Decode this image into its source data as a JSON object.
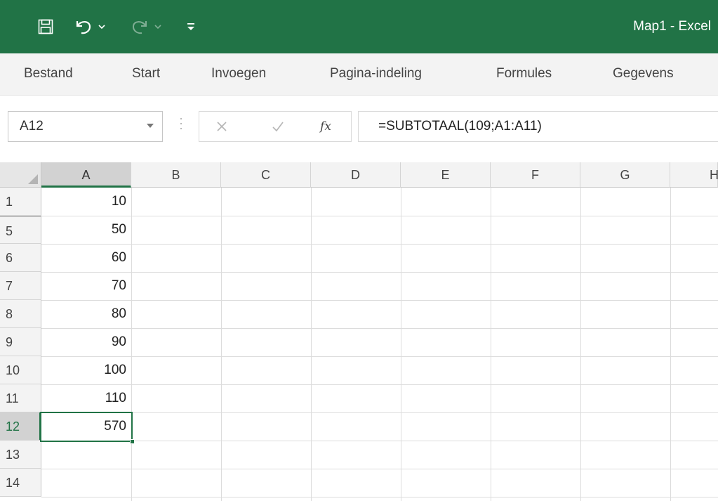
{
  "app": {
    "title": "Map1  -  Excel",
    "quick_access_icons": [
      "save-icon",
      "undo-icon",
      "undo-dropdown-icon",
      "redo-icon",
      "redo-dropdown-icon",
      "customize-qat-icon"
    ]
  },
  "colors": {
    "accent": "#217346",
    "ribbon_bg": "#f3f3f3",
    "header_bg": "#f3f3f3",
    "header_selected_bg": "#d2d2d2",
    "gridline": "#dcdcdc"
  },
  "ribbon": {
    "tabs": [
      "Bestand",
      "Start",
      "Invoegen",
      "Pagina-indeling",
      "Formules",
      "Gegevens"
    ]
  },
  "formula_bar": {
    "name_box": "A12",
    "fx_label": "fx",
    "formula": "=SUBTOTAAL(109;A1:A11)"
  },
  "sheet": {
    "columns": [
      "A",
      "B",
      "C",
      "D",
      "E",
      "F",
      "G",
      "H"
    ],
    "selected_column": "A",
    "rows": [
      {
        "label": "1",
        "a": "10"
      },
      {
        "label": "5",
        "a": "50"
      },
      {
        "label": "6",
        "a": "60"
      },
      {
        "label": "7",
        "a": "70"
      },
      {
        "label": "8",
        "a": "80"
      },
      {
        "label": "9",
        "a": "90"
      },
      {
        "label": "10",
        "a": "100"
      },
      {
        "label": "11",
        "a": "110"
      },
      {
        "label": "12",
        "a": "570"
      },
      {
        "label": "13",
        "a": ""
      },
      {
        "label": "14",
        "a": ""
      }
    ],
    "selected_row": "12",
    "active_cell": "A12"
  }
}
